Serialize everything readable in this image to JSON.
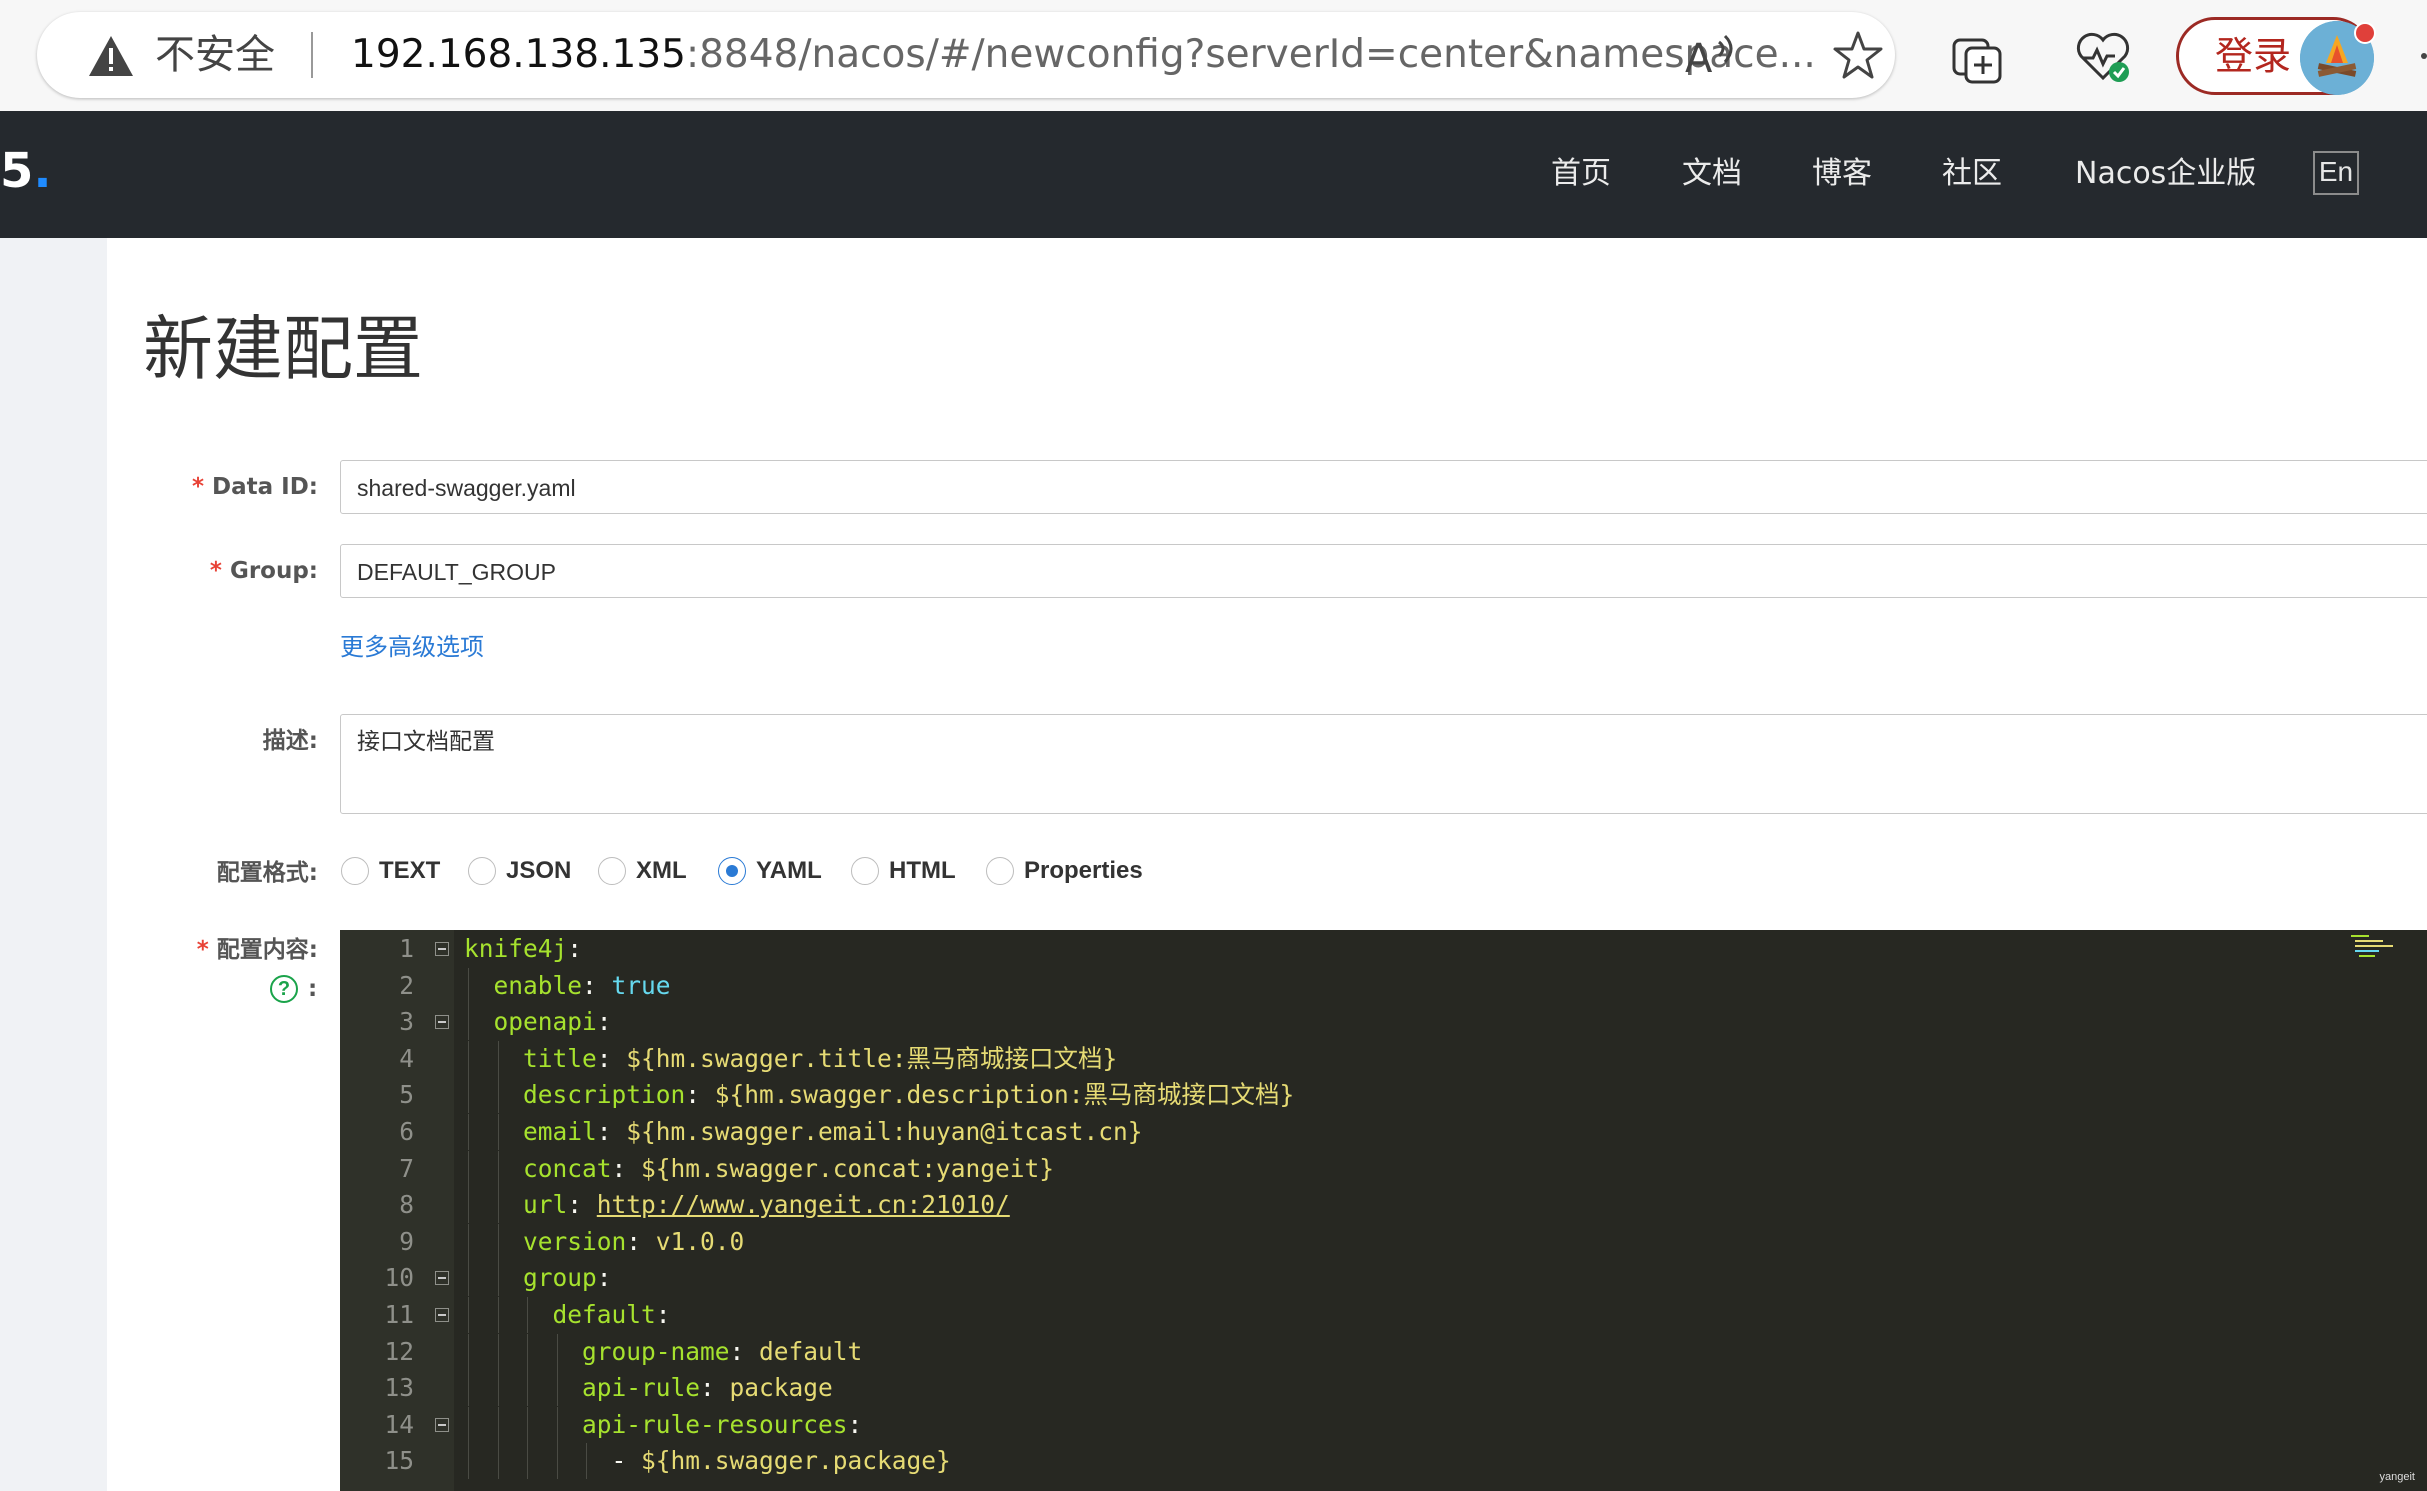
{
  "browser": {
    "security_label": "不安全",
    "url_host": "192.168.138.135",
    "url_rest": ":8848/nacos/#/newconfig?serverId=center&namespace...",
    "login_label": "登录",
    "icons": [
      "warning-icon",
      "read-aloud-icon",
      "star-icon",
      "add-tab-icon",
      "health-icon",
      "avatar",
      "more-icon"
    ]
  },
  "header": {
    "brand_fragment": "5",
    "nav": [
      "首页",
      "文档",
      "博客",
      "社区",
      "Nacos企业版"
    ],
    "lang": "En"
  },
  "page": {
    "title": "新建配置"
  },
  "form": {
    "data_id": {
      "label": "Data ID:",
      "value": "shared-swagger.yaml"
    },
    "group": {
      "label": "Group:",
      "value": "DEFAULT_GROUP"
    },
    "advanced_link": "更多高级选项",
    "description": {
      "label": "描述:",
      "value": "接口文档配置"
    },
    "format": {
      "label": "配置格式:",
      "options": [
        "TEXT",
        "JSON",
        "XML",
        "YAML",
        "HTML",
        "Properties"
      ],
      "selected": "YAML"
    },
    "content": {
      "label": "配置内容:",
      "help_colon": ":"
    }
  },
  "editor": {
    "lines": [
      {
        "n": "1",
        "key": "knife4j",
        "sep": ":",
        "val": "",
        "fold": true
      },
      {
        "n": "2",
        "key": "enable",
        "sep": ": ",
        "val": "true",
        "type": "bool"
      },
      {
        "n": "3",
        "key": "openapi",
        "sep": ":",
        "val": "",
        "fold": true
      },
      {
        "n": "4",
        "key": "title",
        "sep": ": ",
        "val": "${hm.swagger.title:黑马商城接口文档}"
      },
      {
        "n": "5",
        "key": "description",
        "sep": ": ",
        "val": "${hm.swagger.description:黑马商城接口文档}"
      },
      {
        "n": "6",
        "key": "email",
        "sep": ": ",
        "val": "${hm.swagger.email:huyan@itcast.cn}"
      },
      {
        "n": "7",
        "key": "concat",
        "sep": ": ",
        "val": "${hm.swagger.concat:yangeit}"
      },
      {
        "n": "8",
        "key": "url",
        "sep": ": ",
        "val": "http://www.yangeit.cn:21010/",
        "type": "url"
      },
      {
        "n": "9",
        "key": "version",
        "sep": ": ",
        "val": "v1.0.0"
      },
      {
        "n": "10",
        "key": "group",
        "sep": ":",
        "val": "",
        "fold": true
      },
      {
        "n": "11",
        "key": "default",
        "sep": ":",
        "val": "",
        "fold": true
      },
      {
        "n": "12",
        "key": "group-name",
        "sep": ": ",
        "val": "default"
      },
      {
        "n": "13",
        "key": "api-rule",
        "sep": ": ",
        "val": "package"
      },
      {
        "n": "14",
        "key": "api-rule-resources",
        "sep": ":",
        "val": "",
        "fold": true
      },
      {
        "n": "15",
        "key": "- ",
        "sep": "",
        "val": "${hm.swagger.package}",
        "type": "list"
      }
    ],
    "watermark": "yangeit"
  },
  "colors": {
    "nav_bg": "#25292e",
    "accent": "#2a7ad5",
    "required": "#e84236",
    "editor_bg": "#272822",
    "login_border": "#9c2a24"
  }
}
